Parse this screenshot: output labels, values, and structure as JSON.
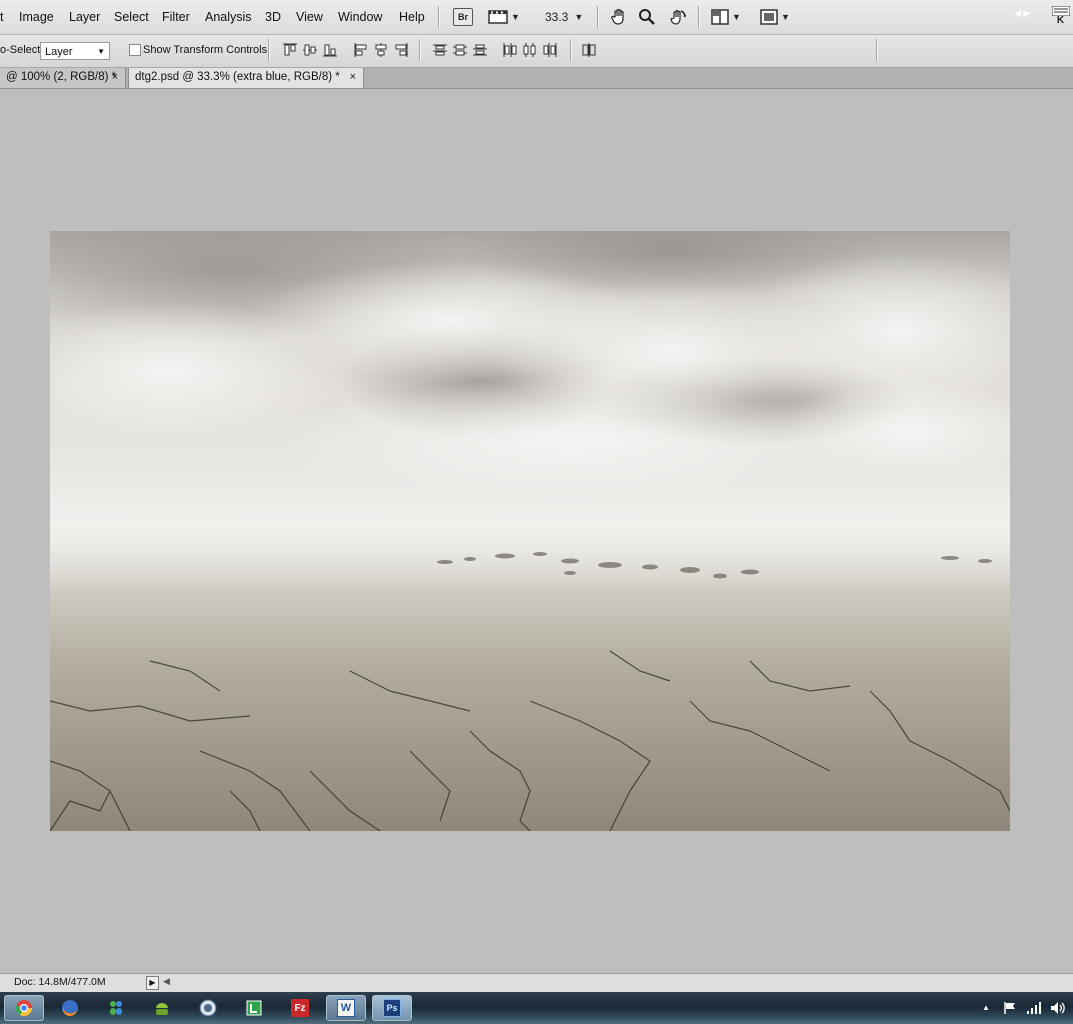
{
  "menubar": {
    "items": [
      "t",
      "Image",
      "Layer",
      "Select",
      "Filter",
      "Analysis",
      "3D",
      "View",
      "Window",
      "Help"
    ],
    "bridge_label": "Br",
    "zoom_value": "33.3",
    "right_logo": "K"
  },
  "options": {
    "autoselect_label": "o-Select:",
    "layer_value": "Layer",
    "transform_label": "Show Transform Controls"
  },
  "tabs": [
    {
      "label": "@ 100% (2, RGB/8) *",
      "close": "×"
    },
    {
      "label": "dtg2.psd @ 33.3% (extra blue, RGB/8) *",
      "close": "×"
    }
  ],
  "status": {
    "doc_size": "Doc: 14.8M/477.0M",
    "arrow": "▶",
    "scroll_left": "◀"
  },
  "colors": {
    "workspace": "#bebebe",
    "menubar": "#e4e4e4",
    "active_tab": "#e3e3e3"
  },
  "taskbar": {
    "apps": [
      "chrome-icon",
      "firefox-icon",
      "messenger-icon",
      "android-icon",
      "itunes-icon",
      "tracker-icon",
      "filezilla-icon",
      "word-icon",
      "photoshop-icon"
    ],
    "word_label": "W",
    "ps_label": "Ps",
    "fz_label": "Fz"
  }
}
